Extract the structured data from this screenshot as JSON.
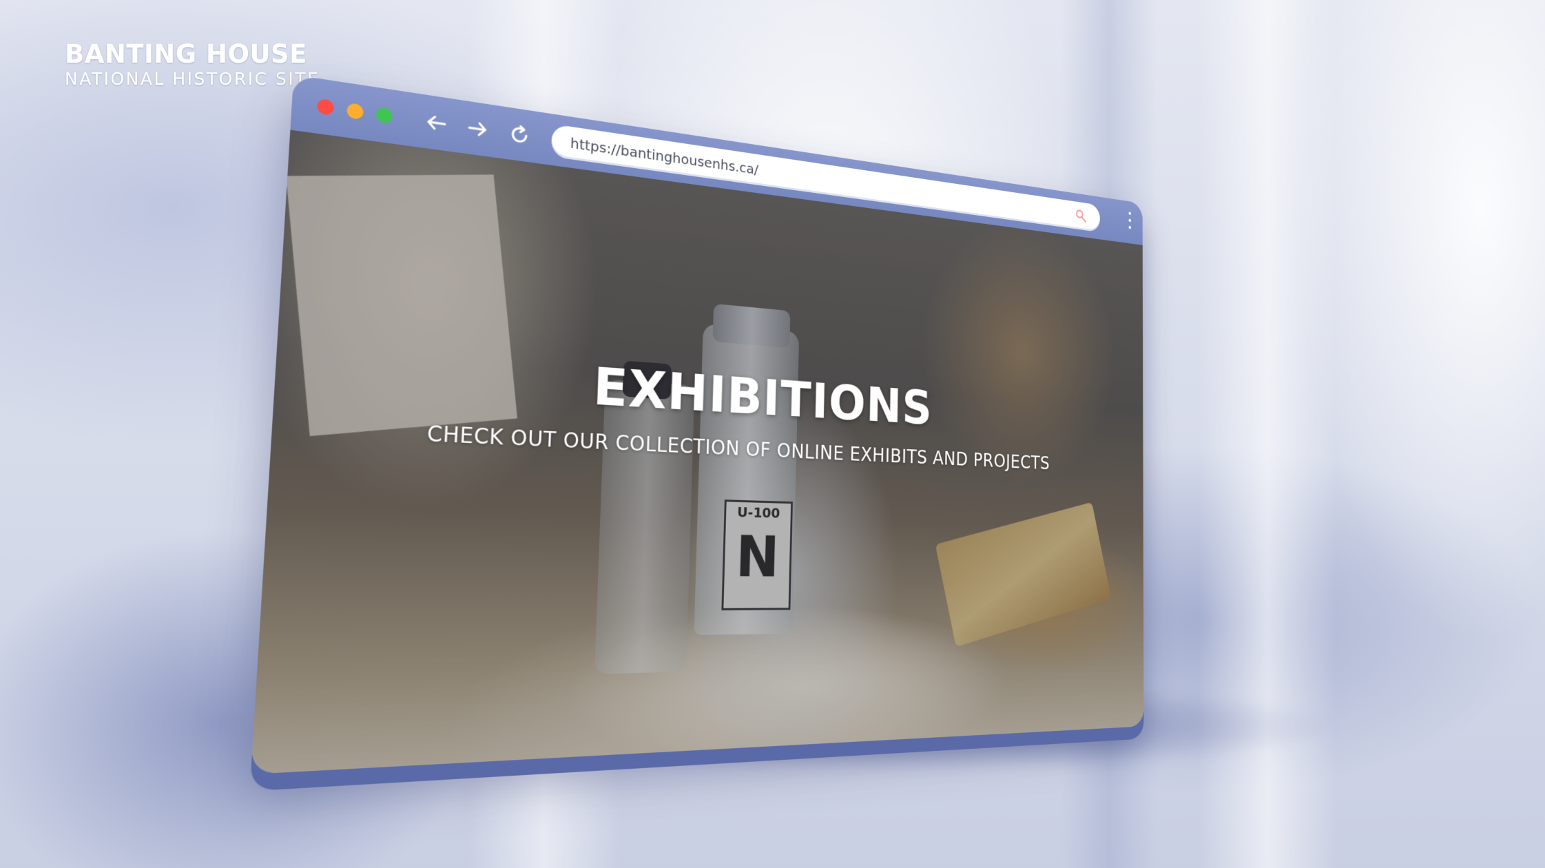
{
  "brand": {
    "title": "BANTING HOUSE",
    "subtitle": "NATIONAL HISTORIC SITE"
  },
  "browser": {
    "traffic_lights": {
      "close_color": "#ff4b45",
      "minimize_color": "#ffae2b",
      "maximize_color": "#3fc650"
    },
    "nav": {
      "back_icon": "arrow-left-icon",
      "forward_icon": "arrow-right-icon",
      "reload_icon": "reload-icon"
    },
    "url": "https://bantinghousenhs.ca/",
    "search_icon_color": "#f3a09a",
    "chrome_color": "#7b8cc2"
  },
  "hero": {
    "title": "EXHIBITIONS",
    "subtitle": "CHECK OUT OUR COLLECTION OF ONLINE EXHIBITS AND PROJECTS",
    "vial_label": {
      "top": "U-100",
      "letter": "N"
    }
  }
}
